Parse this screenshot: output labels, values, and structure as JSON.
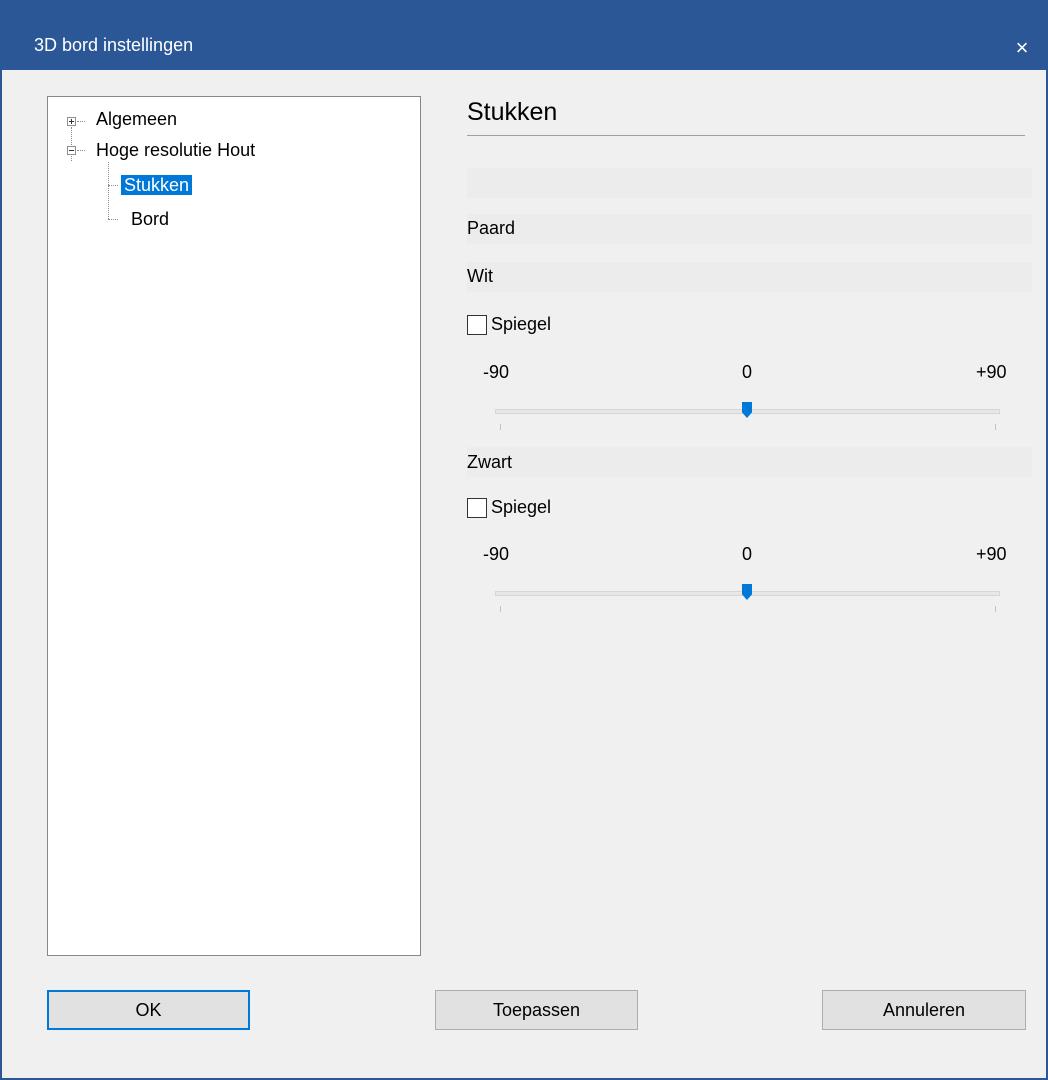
{
  "window": {
    "title": "3D bord instellingen",
    "close_glyph": "×"
  },
  "tree": {
    "items": [
      {
        "label": "Algemeen",
        "expander": "plus"
      },
      {
        "label": "Hoge resolutie Hout",
        "expander": "minus"
      },
      {
        "label": "Stukken",
        "selected": true
      },
      {
        "label": "Bord"
      }
    ]
  },
  "panel": {
    "title": "Stukken",
    "piece_label": "Paard",
    "white": {
      "label": "Wit",
      "mirror_label": "Spiegel",
      "mirror_checked": false,
      "min_label": "-90",
      "mid_label": "0",
      "max_label": "+90",
      "slider_value": 0
    },
    "black": {
      "label": "Zwart",
      "mirror_label": "Spiegel",
      "mirror_checked": false,
      "min_label": "-90",
      "mid_label": "0",
      "max_label": "+90",
      "slider_value": 0
    }
  },
  "buttons": {
    "ok": "OK",
    "apply": "Toepassen",
    "cancel": "Annuleren"
  },
  "colors": {
    "titlebar": "#2b5797",
    "selection": "#0078d7",
    "default_button_border": "#0078d7"
  }
}
